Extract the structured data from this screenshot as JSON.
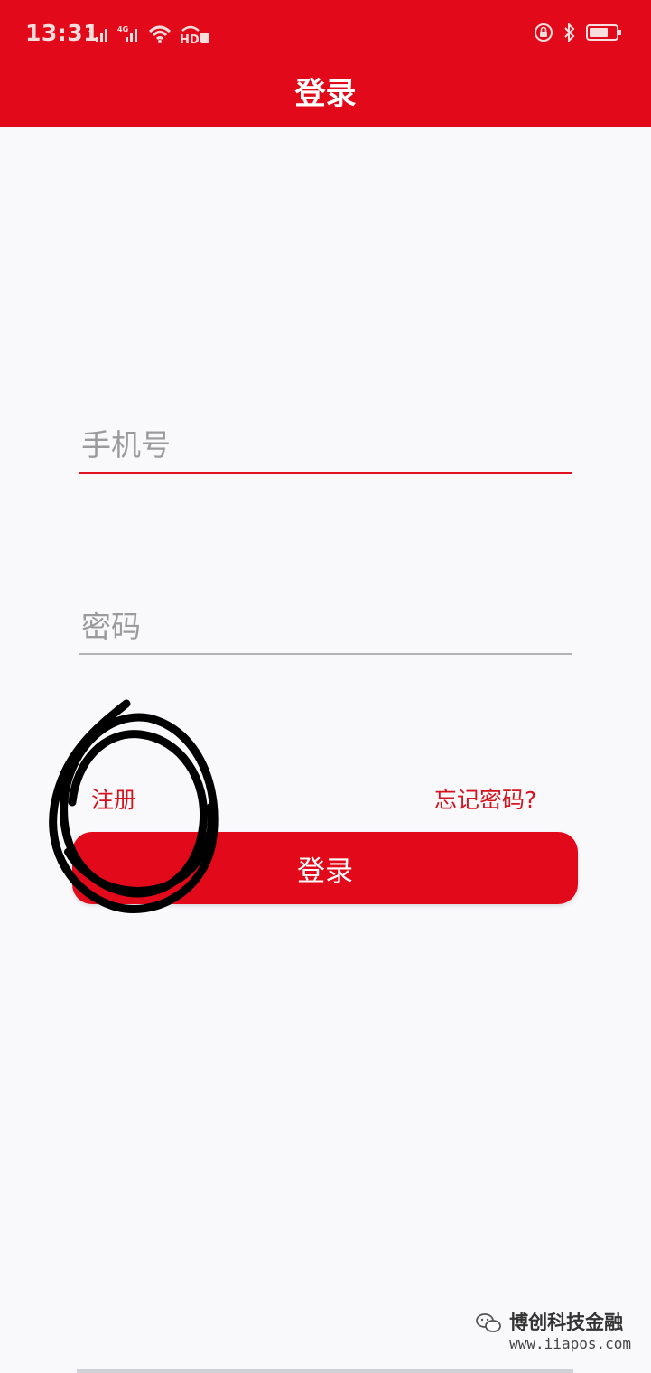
{
  "status_bar": {
    "time": "13:31",
    "hd_badge": "HD",
    "network_badge": "4G",
    "icons": [
      "signal-x-icon",
      "signal-4g-icon",
      "wifi-icon",
      "hd-voice-icon",
      "lock-rotation-icon",
      "bluetooth-icon",
      "battery-icon"
    ]
  },
  "header": {
    "title": "登录"
  },
  "form": {
    "phone": {
      "placeholder": "手机号",
      "value": ""
    },
    "password": {
      "placeholder": "密码",
      "value": ""
    },
    "register_label": "注册",
    "forgot_label": "忘记密码?",
    "login_label": "登录"
  },
  "watermark": {
    "line1": "博创科技金融",
    "line2": "www.iiapos.com"
  },
  "colors": {
    "brand_red": "#e20a1a",
    "link_red": "#d4141f",
    "background": "#f9f8fb",
    "annotation": "#000000"
  }
}
